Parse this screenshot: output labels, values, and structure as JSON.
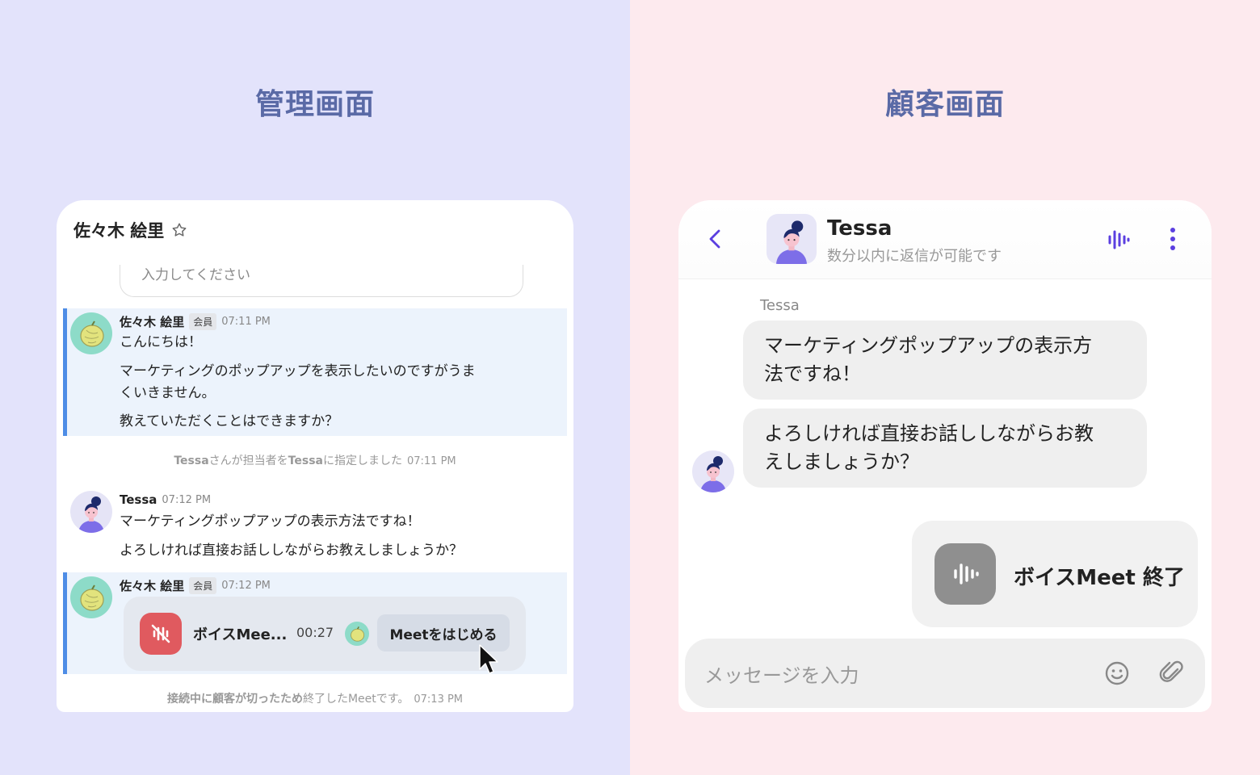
{
  "left_panel": {
    "title": "管理画面"
  },
  "right_panel": {
    "title": "顧客画面"
  },
  "admin": {
    "contact_name": "佐々木 絵里",
    "input_placeholder": "入力してください",
    "messages": [
      {
        "sender": "佐々木 絵里",
        "badge": "会員",
        "time": "07:11 PM",
        "lines": [
          "こんにちは！",
          "マーケティングのポップアップを表示したいのですがうま",
          "くいきません。",
          "教えていただくことはできますか？"
        ]
      },
      {
        "sender": "Tessa",
        "time": "07:12 PM",
        "lines": [
          "マーケティングポップアップの表示方法ですね！",
          "よろしければ直接お話ししながらお教えしましょうか？"
        ]
      },
      {
        "sender": "佐々木 絵里",
        "badge": "会員",
        "time": "07:12 PM"
      }
    ],
    "system_assign": {
      "agent": "Tessa",
      "text_a": "さんが担当者を",
      "assignee": "Tessa",
      "text_b": "に指定しました",
      "time": "07:11 PM"
    },
    "meet_card": {
      "title": "ボイスMee...",
      "duration": "00:27",
      "button": "Meetをはじめる"
    },
    "system_end": {
      "bold_text": "接続中に顧客が切ったため",
      "text": "終了したMeetです。",
      "time": "07:13 PM"
    }
  },
  "customer": {
    "agent_name": "Tessa",
    "status": "数分以内に返信が可能です",
    "sender_label": "Tessa",
    "bubbles": [
      [
        "マーケティングポップアップの表示方",
        "法ですね！"
      ],
      [
        "よろしければ直接お話ししながらお教",
        "えしましょうか？"
      ]
    ],
    "meet_end_label": "ボイスMeet 終了",
    "composer_placeholder": "メッセージを入力"
  },
  "colors": {
    "left_bg": "#e3e3fb",
    "right_bg": "#fdeaee",
    "title": "#5a6aa6",
    "highlight_bar": "#4e8de6",
    "meet_red": "#e05a5f",
    "accent_purple": "#5b3fe0"
  }
}
